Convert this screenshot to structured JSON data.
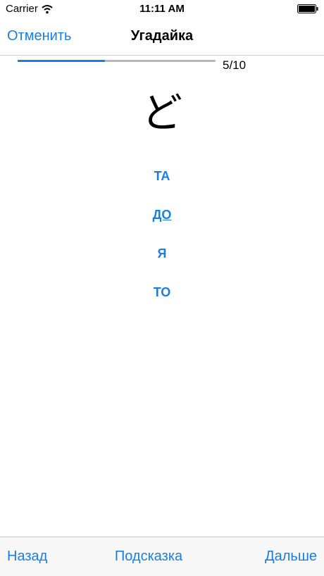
{
  "status_bar": {
    "carrier": "Carrier",
    "time": "11:11 AM",
    "wifi_icon": "wifi-icon",
    "battery_icon": "battery-full-icon"
  },
  "nav": {
    "cancel_label": "Отменить",
    "title": "Угадайка"
  },
  "progress": {
    "current": 5,
    "total": 10,
    "label": "5/10",
    "fraction": 0.44
  },
  "quiz": {
    "character": "ど",
    "options": [
      "ТА",
      "ДО",
      "Я",
      "ТО"
    ]
  },
  "toolbar": {
    "back_label": "Назад",
    "hint_label": "Подсказка",
    "next_label": "Дальше"
  },
  "colors": {
    "accent": "#1a7ee0",
    "progress_track": "#b7b7b7",
    "toolbar_bg": "#f7f7f7"
  }
}
